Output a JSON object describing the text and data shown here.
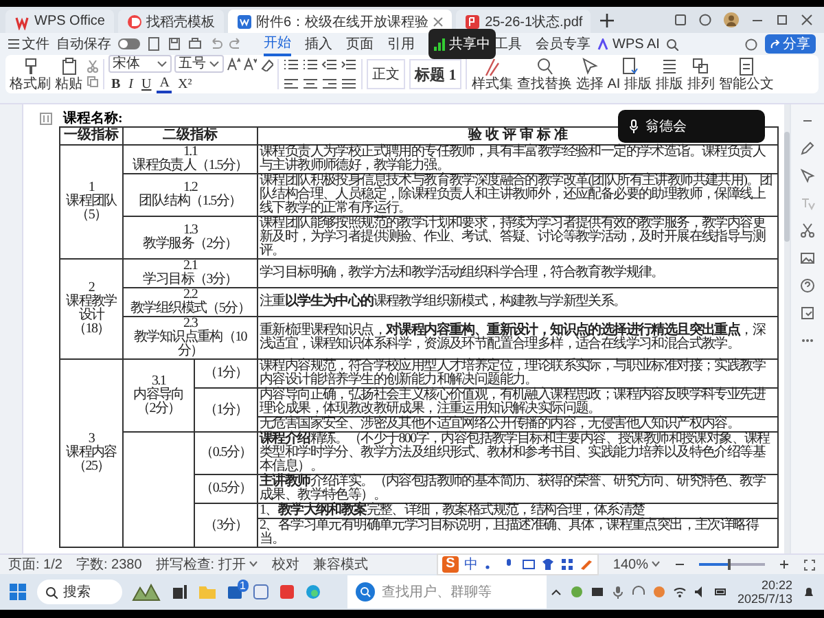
{
  "tabs": [
    {
      "label": "WPS Office",
      "kind": "home",
      "selected": false
    },
    {
      "label": "找稻壳模板",
      "kind": "template",
      "selected": false
    },
    {
      "label": "附件6：校级在线开放课程验",
      "kind": "writer",
      "selected": true
    },
    {
      "label": "25-26-1状态.pdf",
      "kind": "pdf",
      "selected": false
    }
  ],
  "menu": {
    "file": "文件",
    "autosave": {
      "label": "自动保存",
      "on": false
    },
    "tabs": [
      {
        "label": "开始",
        "selected": true
      },
      {
        "label": "插入",
        "selected": false
      },
      {
        "label": "页面",
        "selected": false
      },
      {
        "label": "引用",
        "selected": false
      },
      {
        "label": "工具",
        "selected": false
      },
      {
        "label": "会员专享",
        "selected": false
      }
    ],
    "ai": "WPS AI",
    "share": "分享"
  },
  "ribbon": {
    "clipboard": [
      {
        "label": "格式刷",
        "kind": "brush"
      },
      {
        "label": "粘贴",
        "kind": "paste"
      }
    ],
    "font": {
      "name": "宋体",
      "size": "五号"
    },
    "format_buttons": [
      "B",
      "I",
      "U",
      "A",
      "X²"
    ],
    "styles": [
      "正文",
      "标题 1"
    ],
    "tools": [
      {
        "label": "样式集",
        "kind": "styles"
      },
      {
        "label": "查找替换",
        "kind": "search"
      },
      {
        "label": "选择",
        "kind": "select"
      },
      {
        "label": "AI 排版",
        "kind": "ai"
      },
      {
        "label": "排版",
        "kind": "layout"
      },
      {
        "label": "排列",
        "kind": "arrange"
      },
      {
        "label": "智能公文",
        "kind": "document"
      }
    ]
  },
  "sharing_badge": "共享中",
  "speaker": "翁德会",
  "document": {
    "course_label": "课程名称:",
    "headers": [
      "一级指标",
      "二级指标",
      "验 收 评 审 标 准"
    ],
    "groups": [
      {
        "number": "1",
        "name": "课程团队",
        "points": "（5）",
        "items": [
          {
            "kind": "plain",
            "number": "1.1",
            "title": "课程负责人（1.5分）",
            "criteria": "课程负责人为学校正式聘用的专任教师，具有丰富教学经验和一定的学术造诣。课程负责人与主讲教师师德好，教学能力强。"
          },
          {
            "kind": "plain",
            "number": "1.2",
            "title": "团队结构（1.5分）",
            "criteria": "课程团队积极投身信息技术与教育教学深度融合的教学改革(团队所有主讲教师共建共用)。团队结构合理、人员稳定，除课程负责人和主讲教师外，还应配备必要的助理教师，保障线上线下教学的正常有序运行。"
          },
          {
            "kind": "plain",
            "number": "1.3",
            "title": "教学服务（2分）",
            "criteria": "课程团队能够按照规范的教学计划和要求，持续为学习者提供有效的教学服务，教学内容更新及时，为学习者提供测验、作业、考试、答疑、讨论等教学活动，及时开展在线指导与测评。"
          }
        ]
      },
      {
        "number": "2",
        "name": "课程教学设计",
        "points": "（18）",
        "items": [
          {
            "kind": "plain",
            "number": "2.1",
            "title": "学习目标（3分）",
            "criteria": "学习目标明确，教学方法和教学活动组织科学合理，符合教育教学规律。"
          },
          {
            "kind": "plain",
            "number": "2.2",
            "title": "教学组织模式（5分）",
            "criteria": "注重**以学生为中心的**课程教学组织新模式，构建教与学新型关系。"
          },
          {
            "kind": "plain",
            "number": "2.3",
            "title": "教学知识点重构（10分）",
            "criteria": "重新梳理课程知识点，**对课程内容重构、重新设计，知识点的选择进行精选且突出重点**，深浅适宜，课程知识体系科学，资源及环节配置合理多样，适合在线学习和混合式教学。"
          }
        ]
      },
      {
        "number": "3",
        "name": "课程内容",
        "points": "（25）",
        "items": [
          {
            "kind": "scored",
            "number": "3.1",
            "title": "内容导向",
            "points": "（2分）",
            "rows": [
              {
                "score": "（1分）",
                "criteria": [
                  "课程内容规范，符合学校应用型人才培养定位，理论联系实际，与职业标准对接；实践教学内容设计能培养学生的创新能力和解决问题能力。"
                ]
              },
              {
                "score": "（1分）",
                "criteria": [
                  "内容导向正确，弘扬社会主义核心价值观，有机融入课程思政；课程内容反映学科专业先进理论成果，体现教改教研成果，注重运用知识解决实际问题。",
                  "无危害国家安全、涉密及其他不适宜网络公开传播的内容，无侵害他人知识产权内容。"
                ]
              }
            ]
          },
          {
            "kind": "scored",
            "rows": [
              {
                "score": "（0.5分）",
                "criteria": [
                  "**课程介绍**精练。（不少于800字，内容包括教学目标和主要内容、授课教师和授课对象、课程类型和学时学分、教学方法及组织形式、教材和参考书目、实践能力培养以及特色介绍等基本信息）。"
                ]
              },
              {
                "score": "（0.5分）",
                "criteria": [
                  "**主讲教师**介绍详实。（内容包括教师的基本简历、获得的荣誉、研究方向、研究特色、教学成果、教学特色等）。"
                ]
              },
              {
                "score": "（3分）",
                "criteria": [
                  "1、**教学大纲和教案**完整、详细，教案格式规范，结构合理，体系清楚",
                  "2、各学习单元有明确单元学习目标说明，且描述准确、具体，课程重点突出，主次详略得当。"
                ]
              }
            ]
          }
        ]
      }
    ]
  },
  "status_bar": {
    "items": [
      "页面: 1/2",
      "字数: 2380",
      "拼写检查: 打开",
      "校对",
      "兼容模式"
    ],
    "zoom": "140%",
    "zoom_slider": {
      "level": 0.45
    }
  },
  "ime": {
    "logo": "S",
    "mode": "中"
  },
  "taskbar": {
    "search": "搜索",
    "store_badge": "1",
    "time": "20:22",
    "date": "2025/7/13"
  },
  "chat_popup": {
    "placeholder": "查找用户、群聊等"
  }
}
